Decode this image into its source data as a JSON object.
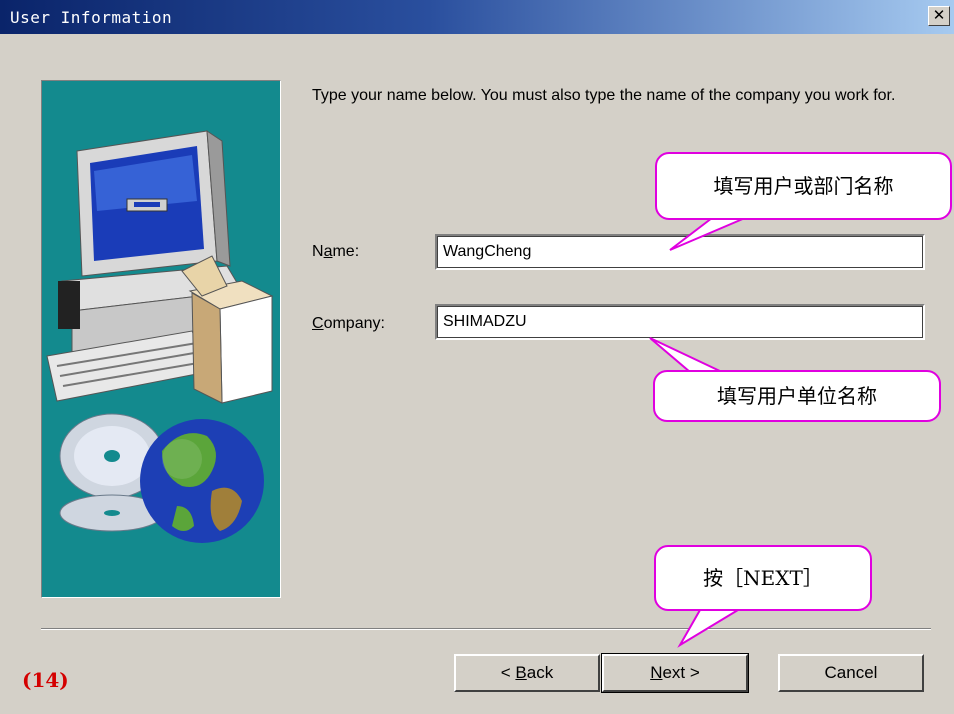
{
  "window": {
    "title": "User Information",
    "close_glyph": "✕"
  },
  "instruction": "Type your name below. You must also type the name of the company you work for.",
  "fields": {
    "name": {
      "label_pre": "N",
      "label_accel": "a",
      "label_post": "me:",
      "value": "WangCheng"
    },
    "company": {
      "label_pre": "",
      "label_accel": "C",
      "label_post": "ompany:",
      "value": "SHIMADZU"
    }
  },
  "buttons": {
    "back": {
      "pre": "< ",
      "accel": "B",
      "post": "ack"
    },
    "next": {
      "pre": "",
      "accel": "N",
      "post": "ext >"
    },
    "cancel": "Cancel"
  },
  "annotations": {
    "name_callout": "填写用户或部门名称",
    "company_callout": "填写用户单位名称",
    "next_callout": "按［NEXT］",
    "step_number": "(14)"
  },
  "colors": {
    "title_bar_start": "#0a246a",
    "title_bar_end": "#a6caf0",
    "dialog_bg": "#d4d0c8",
    "picture_bg": "#138a8e",
    "callout_border": "#e000e0",
    "step_number": "#d40000"
  },
  "icons": [
    "computer-illustration",
    "globe-icon",
    "cd-disc-icon",
    "software-box-icon"
  ]
}
